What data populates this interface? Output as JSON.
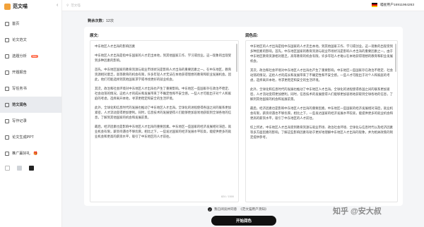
{
  "brand": {
    "name": "范文喵",
    "collapse_icon": "chevron-left-icon"
  },
  "sidebar": {
    "items": [
      {
        "label": "首页",
        "icon": "home-icon",
        "active": false
      },
      {
        "label": "论文范文",
        "icon": "document-icon",
        "active": false
      },
      {
        "label": "选题分析",
        "icon": "analysis-icon",
        "active": false,
        "badge": "free"
      },
      {
        "label": "开题报告",
        "icon": "report-icon",
        "active": false
      },
      {
        "label": "写任务书",
        "icon": "task-icon",
        "active": false
      },
      {
        "label": "范文润色",
        "icon": "polish-icon",
        "active": true
      },
      {
        "label": "写作记录",
        "icon": "history-icon",
        "active": false
      },
      {
        "label": "论文生成PPT",
        "icon": "ppt-icon",
        "active": false
      },
      {
        "label": "推广赢好礼",
        "icon": "gift-icon",
        "active": false,
        "badge": "🎁"
      }
    ],
    "theme_swatches": [
      "#ffffff",
      "#cfd3d8",
      "#222222"
    ]
  },
  "topbar": {
    "search_placeholder": "范文喵",
    "user_label": "喵星用户16911964263",
    "flag_icon": "germany-flag-icon"
  },
  "main": {
    "count_label": "剩余次数：",
    "count_value": "12次",
    "original_label": "原文:",
    "polished_label": "润色后:",
    "char_count": "824 / 1500",
    "original_paragraphs": [
      "中东地区人才出海的影响因素",
      "中东地区人才出海是指中东国家的人才走出本地，到其他国家工作、学习或创业。这一现象的出现受到多种因素的影响。",
      "首先，中东地区国家的教育资源与就业市场状况是影响人才出海的重要因素之一。在中东地区，教育资源相对匮乏，高等教育的机会有限，许多年轻人才无法在本地获得理想的教育和职业发展机会。因此，他们可能选择到其他国家求学或寻找更好的就业机会。",
      "其次，政治和社会环境对中东地区人才出海也产生了重要影响。中东地区一些国家存在政治不稳定、社会动荡的情况，这给人才的成长和发展带来了不确定性和不安全感。一些人才可能出于对个人和家庭的考虑，选择离开本地，寻求更稳定和安全的生活环境。",
      "此外，全球化和信息时代的发展也推动了中东地区人才出海。全球化的进程使得各国之间的联系更加紧密，人才流动变得更加便利。同时，信息技术的发展使得人们能够更加容易地获取到全球各地的信息，了解到其他国家的机会和发展前景。",
      "最后，经济因素也是影响中东地区人才出海的重要因素。中东地区一些国家的经济发展相对滞后，就业机会有限，薪资待遇也不够优厚。相比之下，一些发达国家的经济发展水平较高，能提供更多的就业机会和更高的薪资水平，吸引了中东地区的人才前往。"
    ],
    "polished_paragraphs": [
      "中东地区的人才出海是指中东国家的人才走出本地，到其他国家工作、学习或创业。这一现象的出现受到多种因素的影响。首先，中东地区国家的教育资源与就业市场状况是影响人才出海的重要因素之一。由于中东地区教育资源相对匮乏，高等教育的机会有限，许多年轻人才难以在本地获得理想的教育和职业发展机会。",
      "其次，政治和社会环境对中东地区人才出海也产生了重要影响。中东地区一些国家存在政治不稳定、社会动荡的情况，这给人才的成长和发展带来了不确定性和不安全感。一些人才可能出于对个人和家庭的考虑，选择离开本地，寻求更稳定和安全的生活环境。",
      "此外，全球化和信息时代的发展也推动了中东地区人才出海。全球化的进程使得各国之间的联系更加紧密，人才流动变得更加便利。同时，信息技术的发展使得人们能够更加容易地获取到全球各地的信息，了解到其他国家的机会和发展前景。",
      "最后，经济因素也是影响中东地区人才出海的重要因素。中东地区一些国家的经济发展相对滞后，就业机会有限，薪资待遇也不够优厚。相比之下，一些发达国家的经济发展水平较高，能提供更多的就业机会和更高的薪资水平，吸引了中东地区的人才前往。",
      "综上所述，中东地区人才出海受到教育资源与就业市场、政治社会环境、全球化与信息时代以及经济因素等多方面因素的影响。了解这些影响因素有助于更好地理解中东地区人才出海的现象，并为相关政策的制定提供参考。"
    ]
  },
  "footer": {
    "agree_prefix": "我已阅读并同意",
    "agree_link": "《范文猫用户须知》",
    "start_button": "开始润色"
  },
  "watermark": "知乎 @安大叔"
}
